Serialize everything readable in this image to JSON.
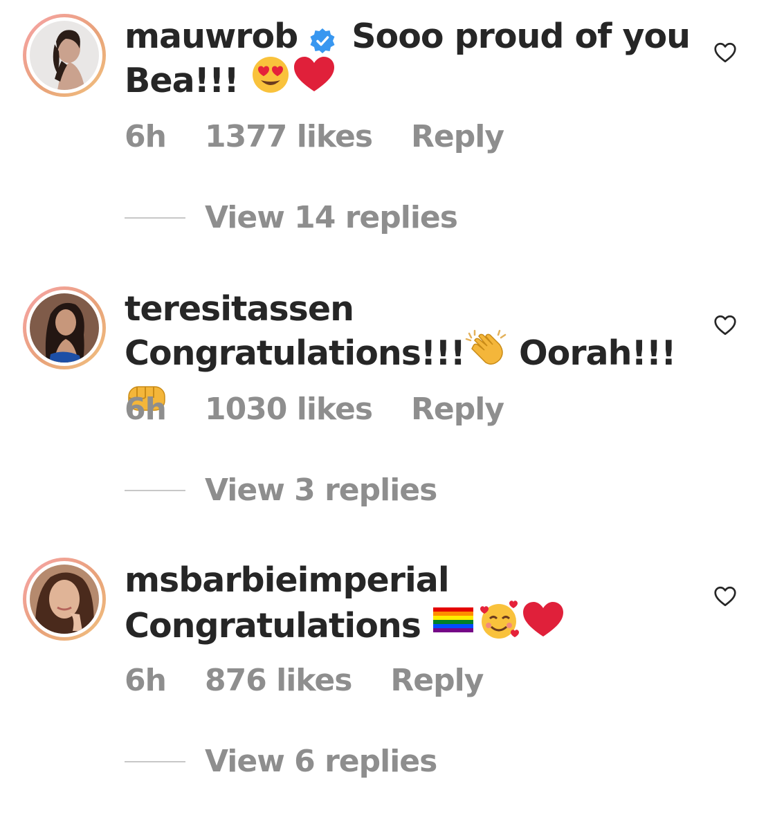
{
  "comments": [
    {
      "username": "mauwrob",
      "verified": true,
      "text": "Sooo proud of you Bea!!!",
      "emojis": [
        "heart-eyes-emoji",
        "red-heart-emoji"
      ],
      "time": "6h",
      "likes": "1377 likes",
      "reply_label": "Reply",
      "view_replies": "View 14 replies"
    },
    {
      "username": "teresitassen",
      "verified": false,
      "text_part1": "Congratulations!!!",
      "text_part2": "Oorah!!!",
      "emojis": [
        "clapping-hands-emoji",
        "fist-emoji"
      ],
      "time": "6h",
      "likes": "1030 likes",
      "reply_label": "Reply",
      "view_replies": "View 3 replies"
    },
    {
      "username": "msbarbieimperial",
      "verified": false,
      "text": "Congratulations",
      "emojis": [
        "rainbow-flag-emoji",
        "smiling-face-with-hearts-emoji",
        "red-heart-emoji"
      ],
      "time": "6h",
      "likes": "876 likes",
      "reply_label": "Reply",
      "view_replies": "View 6 replies"
    }
  ],
  "colors": {
    "text": "#262626",
    "meta": "#8e8e8e",
    "verified": "#3897f0",
    "story_ring": "#e8a279"
  }
}
